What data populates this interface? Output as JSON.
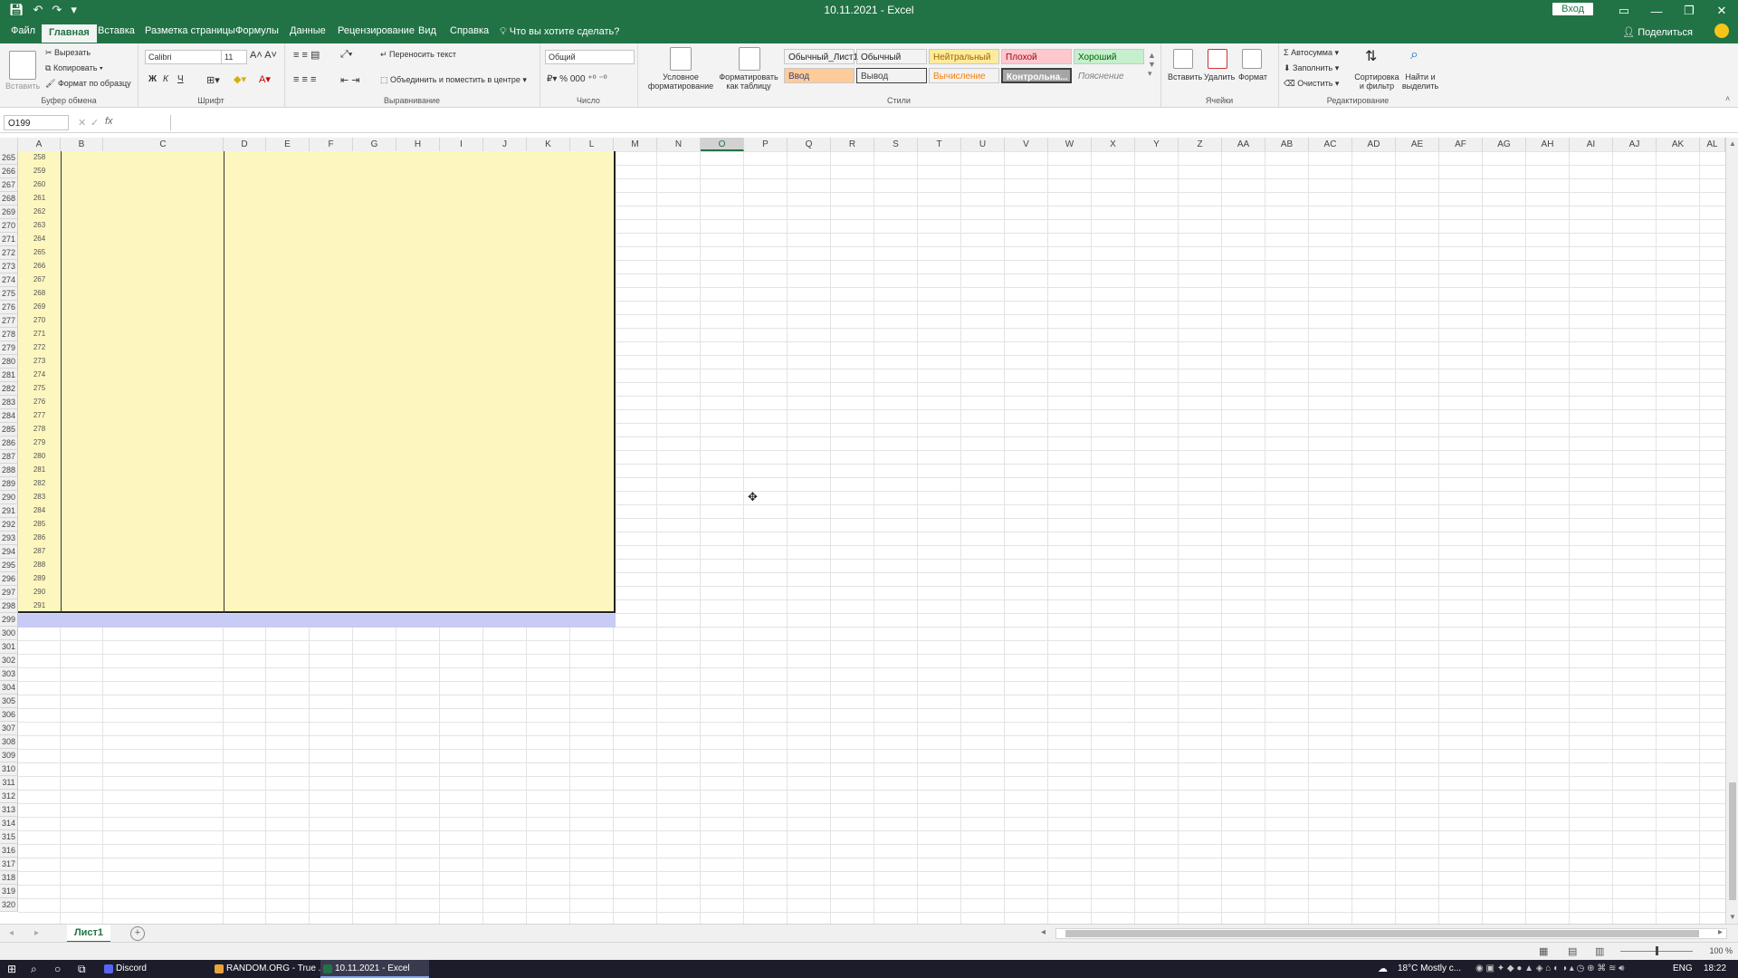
{
  "window": {
    "title": "10.11.2021  -  Excel",
    "signin": "Вход",
    "share": "Поделиться",
    "tell_me": "Что вы хотите сделать?"
  },
  "tabs": [
    "Файл",
    "Главная",
    "Вставка",
    "Разметка страницы",
    "Формулы",
    "Данные",
    "Рецензирование",
    "Вид",
    "Справка"
  ],
  "ribbon": {
    "clipboard": {
      "label": "Буфер обмена",
      "paste": "Вставить",
      "cut": "Вырезать",
      "copy": "Копировать",
      "format_painter": "Формат по образцу"
    },
    "font": {
      "label": "Шрифт",
      "name": "Calibri",
      "size": "11",
      "bold": "Ж",
      "italic": "К",
      "underline": "Ч"
    },
    "alignment": {
      "label": "Выравнивание",
      "wrap": "Переносить текст",
      "merge": "Объединить и поместить в центре"
    },
    "number": {
      "label": "Число",
      "format": "Общий"
    },
    "styles": {
      "label": "Стили",
      "conditional": "Условное форматирование",
      "format_table": "Форматировать как таблицу",
      "cells": [
        {
          "name": "Обычный_Лист1",
          "bg": "#ffffff",
          "fg": "#222222"
        },
        {
          "name": "Обычный",
          "bg": "#ffffff",
          "fg": "#222222"
        },
        {
          "name": "Нейтральный",
          "bg": "#ffeb9c",
          "fg": "#9c6500"
        },
        {
          "name": "Плохой",
          "bg": "#ffc7ce",
          "fg": "#9c0006"
        },
        {
          "name": "Хороший",
          "bg": "#c6efce",
          "fg": "#006100"
        },
        {
          "name": "Ввод",
          "bg": "#ffcc99",
          "fg": "#3f3f76"
        },
        {
          "name": "Вывод",
          "bg": "#f2f2f2",
          "fg": "#3f3f3f"
        },
        {
          "name": "Вычисление",
          "bg": "#f2f2f2",
          "fg": "#fa7d00"
        },
        {
          "name": "Контрольна...",
          "bg": "#a5a5a5",
          "fg": "#ffffff"
        },
        {
          "name": "Пояснение",
          "bg": "#ffffff",
          "fg": "#7f7f7f"
        }
      ]
    },
    "cells": {
      "label": "Ячейки",
      "insert": "Вставить",
      "delete": "Удалить",
      "format": "Формат"
    },
    "editing": {
      "label": "Редактирование",
      "autosum": "Автосумма",
      "fill": "Заполнить",
      "clear": "Очистить",
      "sort": "Сортировка и фильтр",
      "find": "Найти и выделить"
    }
  },
  "formula_bar": {
    "name_box": "O199",
    "fx": "fx",
    "value": ""
  },
  "columns": [
    "A",
    "B",
    "C",
    "D",
    "E",
    "F",
    "G",
    "H",
    "I",
    "J",
    "K",
    "L",
    "M",
    "N",
    "O",
    "P",
    "Q",
    "R",
    "S",
    "T",
    "U",
    "V",
    "W",
    "X",
    "Y",
    "Z",
    "AA",
    "AB",
    "AC",
    "AD",
    "AE",
    "AF",
    "AG",
    "AH",
    "AI",
    "AJ",
    "AK",
    "AL"
  ],
  "selected_column": "O",
  "rows": {
    "first": 265,
    "last": 321,
    "a_values_first": 258,
    "a_values_last": 291
  },
  "sheets": {
    "active": "Лист1"
  },
  "status": {
    "zoom": "100 %"
  },
  "taskbar": {
    "apps": [
      {
        "label": "Discord",
        "color": "#5865f2"
      },
      {
        "label": "RANDOM.ORG - True ...",
        "color": "#e8a33d"
      },
      {
        "label": "10.11.2021 - Excel",
        "color": "#217346"
      }
    ],
    "weather": "18°C  Mostly c...",
    "lang": "ENG",
    "time": "18:22"
  }
}
